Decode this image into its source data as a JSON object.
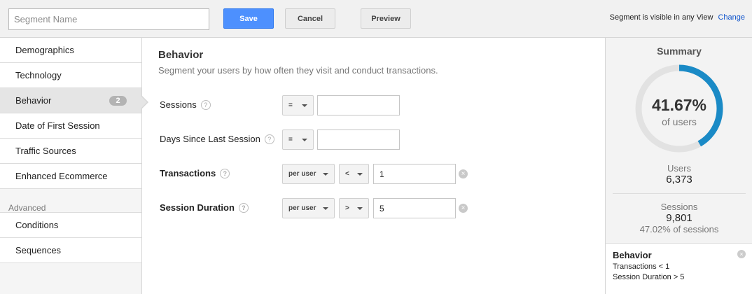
{
  "topbar": {
    "segment_name_placeholder": "Segment Name",
    "segment_name_value": "",
    "save_label": "Save",
    "cancel_label": "Cancel",
    "preview_label": "Preview",
    "visibility_text": "Segment is visible in any View",
    "change_label": "Change"
  },
  "sidebar": {
    "items": [
      {
        "label": "Demographics"
      },
      {
        "label": "Technology"
      },
      {
        "label": "Behavior",
        "badge": "2"
      },
      {
        "label": "Date of First Session"
      },
      {
        "label": "Traffic Sources"
      },
      {
        "label": "Enhanced Ecommerce"
      }
    ],
    "group_label": "Advanced",
    "advanced_items": [
      {
        "label": "Conditions"
      },
      {
        "label": "Sequences"
      }
    ]
  },
  "main": {
    "title": "Behavior",
    "subtitle": "Segment your users by how often they visit and conduct transactions.",
    "help_glyph": "?",
    "clear_glyph": "×",
    "rows": [
      {
        "label": "Sessions",
        "operator": "=",
        "value": ""
      },
      {
        "label": "Days Since Last Session",
        "operator": "=",
        "value": ""
      },
      {
        "label": "Transactions",
        "scope": "per user",
        "operator": "<",
        "value": "1"
      },
      {
        "label": "Session Duration",
        "scope": "per user",
        "operator": ">",
        "value": "5"
      }
    ]
  },
  "summary": {
    "title": "Summary",
    "percent": "41.67%",
    "percent_value": 41.67,
    "percent_sub": "of users",
    "users_label": "Users",
    "users_value": "6,373",
    "sessions_label": "Sessions",
    "sessions_value": "9,801",
    "sessions_pct": "47.02% of sessions",
    "criteria": {
      "title": "Behavior",
      "lines": [
        "Transactions < 1",
        "Session Duration > 5"
      ]
    },
    "colors": {
      "arc": "#1a8ac6",
      "track": "#e2e2e2"
    }
  }
}
